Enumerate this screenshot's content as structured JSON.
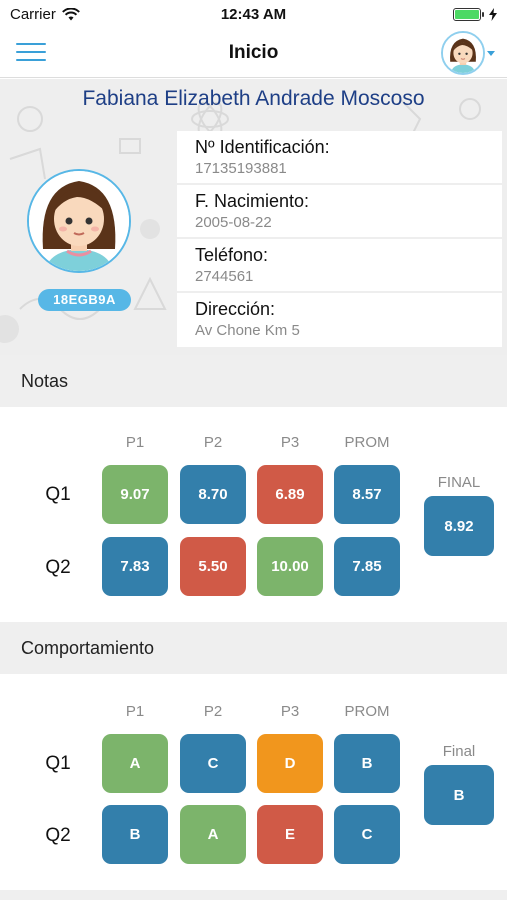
{
  "status_bar": {
    "carrier": "Carrier",
    "time": "12:43 AM"
  },
  "nav": {
    "title": "Inicio",
    "menu_icon": "hamburger-icon",
    "avatar_icon": "student-avatar-icon"
  },
  "student": {
    "name": "Fabiana Elizabeth Andrade Moscoso",
    "code": "18EGB9A",
    "fields": [
      {
        "label": "Nº Identificación:",
        "value": "17135193881"
      },
      {
        "label": "F. Nacimiento:",
        "value": "2005-08-22"
      },
      {
        "label": "Teléfono:",
        "value": "2744561"
      },
      {
        "label": "Dirección:",
        "value": "Av Chone Km 5"
      }
    ]
  },
  "colors": {
    "green": "#7cb46b",
    "blue": "#337fab",
    "red": "#d05a47",
    "orange": "#f1961d",
    "accent": "#57b7e6",
    "name_blue": "#1e3f86"
  },
  "notas": {
    "title": "Notas",
    "columns": [
      "P1",
      "P2",
      "P3",
      "PROM"
    ],
    "rows": [
      {
        "label": "Q1",
        "cells": [
          {
            "value": "9.07",
            "color": "green"
          },
          {
            "value": "8.70",
            "color": "blue"
          },
          {
            "value": "6.89",
            "color": "red"
          },
          {
            "value": "8.57",
            "color": "blue"
          }
        ]
      },
      {
        "label": "Q2",
        "cells": [
          {
            "value": "7.83",
            "color": "blue"
          },
          {
            "value": "5.50",
            "color": "red"
          },
          {
            "value": "10.00",
            "color": "green"
          },
          {
            "value": "7.85",
            "color": "blue"
          }
        ]
      }
    ],
    "final_label": "FINAL",
    "final_value": "8.92"
  },
  "comportamiento": {
    "title": "Comportamiento",
    "columns": [
      "P1",
      "P2",
      "P3",
      "PROM"
    ],
    "rows": [
      {
        "label": "Q1",
        "cells": [
          {
            "value": "A",
            "color": "green"
          },
          {
            "value": "C",
            "color": "blue"
          },
          {
            "value": "D",
            "color": "orange"
          },
          {
            "value": "B",
            "color": "blue"
          }
        ]
      },
      {
        "label": "Q2",
        "cells": [
          {
            "value": "B",
            "color": "blue"
          },
          {
            "value": "A",
            "color": "green"
          },
          {
            "value": "E",
            "color": "red"
          },
          {
            "value": "C",
            "color": "blue"
          }
        ]
      }
    ],
    "final_label": "Final",
    "final_value": "B"
  }
}
